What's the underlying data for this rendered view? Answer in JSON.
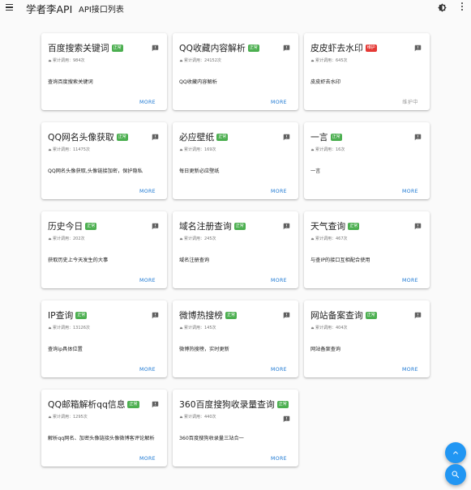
{
  "header": {
    "brand": "学者李API",
    "nav_label": "API接口列表",
    "menu_icon": "menu-icon",
    "theme_icon": "brightness-icon",
    "more_icon": "more-vert-icon"
  },
  "colors": {
    "accent": "#1976d2",
    "badge_ok": "#4caf50",
    "badge_maint": "#e53935",
    "fab": "#2196f3"
  },
  "cards": [
    {
      "title": "百度搜索关键词",
      "badge": "正常",
      "status": "ok",
      "calls": "累计调用：984次",
      "desc": "查询百度搜索关键词",
      "action": "MORE"
    },
    {
      "title": "QQ收藏内容解析",
      "badge": "正常",
      "status": "ok",
      "calls": "累计调用：24152次",
      "desc": "QQ收藏内容解析",
      "action": "MORE"
    },
    {
      "title": "皮皮虾去水印",
      "badge": "维护",
      "status": "maint",
      "calls": "累计调用：645次",
      "desc": "皮皮虾去水印",
      "action": "维护中"
    },
    {
      "title": "QQ网名头像获取",
      "badge": "正常",
      "status": "ok",
      "calls": "累计调用：11475次",
      "desc": "QQ网名头像获取,头像链接加密，保护隐私",
      "action": "MORE"
    },
    {
      "title": "必应壁纸",
      "badge": "正常",
      "status": "ok",
      "calls": "累计调用：169次",
      "desc": "每日更新必应壁纸",
      "action": "MORE"
    },
    {
      "title": "一言",
      "badge": "正常",
      "status": "ok",
      "calls": "累计调用：16次",
      "desc": "一言",
      "action": "MORE"
    },
    {
      "title": "历史今日",
      "badge": "正常",
      "status": "ok",
      "calls": "累计调用：202次",
      "desc": "获取历史上今天发生的大事",
      "action": "MORE"
    },
    {
      "title": "域名注册查询",
      "badge": "正常",
      "status": "ok",
      "calls": "累计调用：245次",
      "desc": "域名注册查询",
      "action": "MORE"
    },
    {
      "title": "天气查询",
      "badge": "正常",
      "status": "ok",
      "calls": "累计调用：467次",
      "desc": "与查IP的接口互相配合使用",
      "action": "MORE"
    },
    {
      "title": "IP查询",
      "badge": "正常",
      "status": "ok",
      "calls": "累计调用：13126次",
      "desc": "查询ip具体位置",
      "action": "MORE"
    },
    {
      "title": "微博热搜榜",
      "badge": "正常",
      "status": "ok",
      "calls": "累计调用：145次",
      "desc": "微博热搜榜，实时更新",
      "action": "MORE"
    },
    {
      "title": "网站备案查询",
      "badge": "正常",
      "status": "ok",
      "calls": "累计调用：404次",
      "desc": "网站备案查询",
      "action": "MORE"
    },
    {
      "title": "QQ邮箱解析qq信息",
      "badge": "正常",
      "status": "ok",
      "calls": "累计调用：1295次",
      "desc": "解析qq网名、加密头像链接头像微博客评论解析",
      "action": "MORE"
    },
    {
      "title": "360百度搜狗收录量查询",
      "badge": "正常",
      "status": "ok",
      "calls": "累计调用：440次",
      "desc": "360百度搜狗收录量三站合一",
      "action": "MORE"
    }
  ],
  "fabs": {
    "up_icon": "chevron-up-icon",
    "search_icon": "search-icon"
  }
}
